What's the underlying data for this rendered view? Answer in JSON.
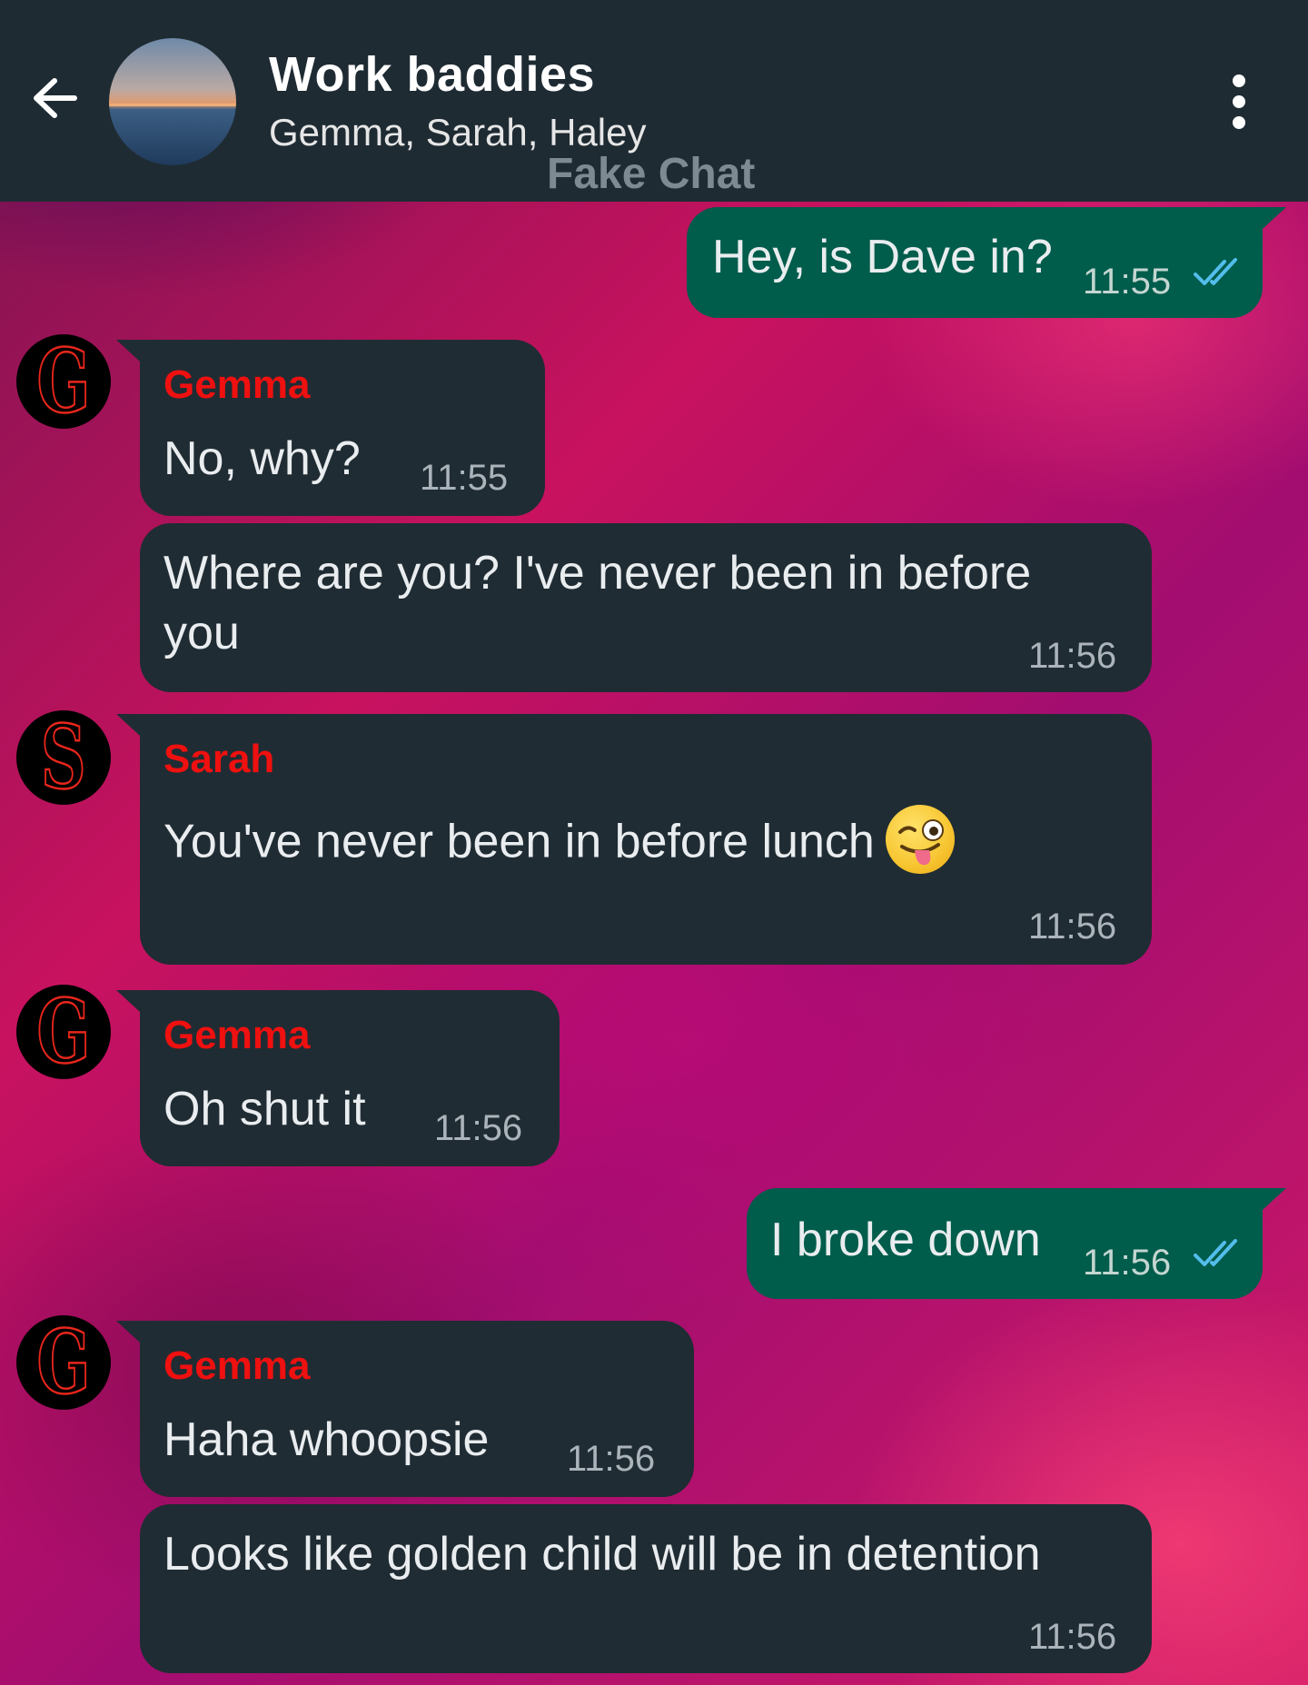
{
  "header": {
    "title": "Work baddies",
    "subtitle": "Gemma, Sarah, Haley",
    "watermark": "Fake Chat"
  },
  "messages": [
    {
      "type": "outgoing",
      "text": "Hey, is Dave in?",
      "time": "11:55",
      "status": "read"
    },
    {
      "type": "incoming",
      "sender": "Gemma",
      "avatar": "G",
      "text": "No, why?",
      "time": "11:55"
    },
    {
      "type": "incoming",
      "text": "Where are you? I've never been in before you",
      "time": "11:56"
    },
    {
      "type": "incoming",
      "sender": "Sarah",
      "avatar": "S",
      "text": "You've never been in before lunch",
      "emoji": "winking-face-with-tongue",
      "time": "11:56"
    },
    {
      "type": "incoming",
      "sender": "Gemma",
      "avatar": "G",
      "text": "Oh shut it",
      "time": "11:56"
    },
    {
      "type": "outgoing",
      "text": "I broke down",
      "time": "11:56",
      "status": "read"
    },
    {
      "type": "incoming",
      "sender": "Gemma",
      "avatar": "G",
      "text": "Haha whoopsie",
      "time": "11:56"
    },
    {
      "type": "incoming",
      "text": "Looks like golden child will be in detention",
      "time": "11:56"
    }
  ],
  "colors": {
    "header_bg": "#1f2b33",
    "incoming_bubble": "#202c33",
    "outgoing_bubble": "#005c4b",
    "sender_name": "#ef1010",
    "read_ticks": "#53bdeb"
  }
}
